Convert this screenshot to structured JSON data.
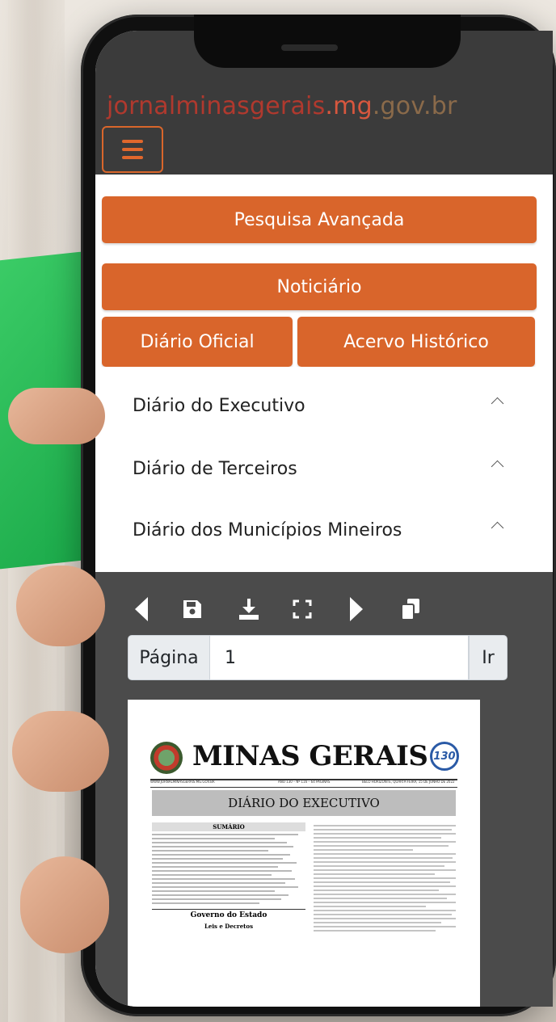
{
  "site": {
    "url_part_a": "jornalminasgerais",
    "url_part_b": ".mg",
    "url_part_c": ".gov.br"
  },
  "buttons": {
    "pesquisa": "Pesquisa Avançada",
    "noticiario": "Noticiário",
    "diario_oficial": "Diário Oficial",
    "acervo": "Acervo Histórico"
  },
  "accordion": [
    {
      "label": "Diário do Executivo"
    },
    {
      "label": "Diário de Terceiros"
    },
    {
      "label": "Diário dos Municípios Mineiros"
    }
  ],
  "viewer": {
    "page_label": "Página",
    "page_value": "1",
    "go_label": "Ir",
    "tools": [
      "prev-icon",
      "save-icon",
      "download-icon",
      "fullscreen-icon",
      "next-icon",
      "copy-icon"
    ]
  },
  "document": {
    "masthead": "MINAS GERAIS",
    "anniversary": "130",
    "meta_left": "WWW.JORNALMINASGERAIS.MG.GOV.BR",
    "meta_mid": "ANO 130 – Nº 116 – 64 PÁGINAS",
    "meta_right": "BELO HORIZONTE, QUARTA-FEIRA, 15 DE JUNHO DE 2022",
    "section": "DIÁRIO DO EXECUTIVO",
    "summary_title": "SUMÁRIO",
    "gov_title": "Governo do Estado",
    "leis_title": "Leis e Decretos"
  },
  "colors": {
    "accent": "#d9652b",
    "topbar": "#3b3b3b",
    "viewer": "#4b4b4b"
  }
}
